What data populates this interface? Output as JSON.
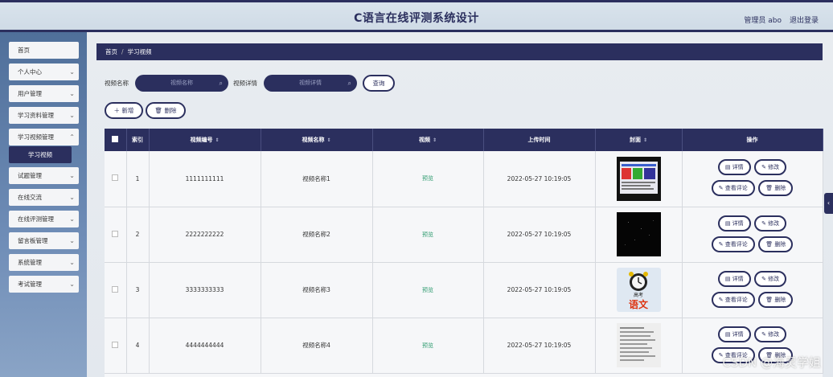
{
  "header": {
    "title": "C语言在线评测系统设计",
    "user": "管理员 abo",
    "logout": "退出登录"
  },
  "sidebar": {
    "items": [
      {
        "label": "首页",
        "chevron": false
      },
      {
        "label": "个人中心",
        "chevron": true
      },
      {
        "label": "用户管理",
        "chevron": true
      },
      {
        "label": "学习资料管理",
        "chevron": true
      },
      {
        "label": "学习视频管理",
        "chevron": true
      },
      {
        "label": "学习视频",
        "sub": true
      },
      {
        "label": "试题管理",
        "chevron": true
      },
      {
        "label": "在线交流",
        "chevron": true
      },
      {
        "label": "在线评测管理",
        "chevron": true
      },
      {
        "label": "留言板管理",
        "chevron": true
      },
      {
        "label": "系统管理",
        "chevron": true
      },
      {
        "label": "考试管理",
        "chevron": true
      }
    ]
  },
  "breadcrumb": {
    "home": "首页",
    "sep": "/",
    "current": "学习视频"
  },
  "search": {
    "name_label": "视频名称",
    "name_placeholder": "视频名称",
    "detail_label": "视频详情",
    "detail_placeholder": "视频详情",
    "query": "查询"
  },
  "actions": {
    "add": "新增",
    "delete": "删除"
  },
  "table": {
    "columns": [
      "索引",
      "视频编号",
      "视频名称",
      "视频",
      "上传时间",
      "封面",
      "操作"
    ],
    "rows": [
      {
        "index": "1",
        "code": "1111111111",
        "name": "视频名称1",
        "video": "预览",
        "time": "2022-05-27 10:19:05"
      },
      {
        "index": "2",
        "code": "2222222222",
        "name": "视频名称2",
        "video": "预览",
        "time": "2022-05-27 10:19:05"
      },
      {
        "index": "3",
        "code": "3333333333",
        "name": "视频名称3",
        "video": "预览",
        "time": "2022-05-27 10:19:05"
      },
      {
        "index": "4",
        "code": "4444444444",
        "name": "视频名称4",
        "video": "预览",
        "time": "2022-05-27 10:19:05"
      }
    ],
    "ops": {
      "detail": "详情",
      "edit": "修改",
      "comments": "查看评论",
      "delete": "删除"
    }
  },
  "cover3_text": {
    "top": "高考",
    "bottom": "语文"
  },
  "watermark": "CSDN @海灵学姐"
}
